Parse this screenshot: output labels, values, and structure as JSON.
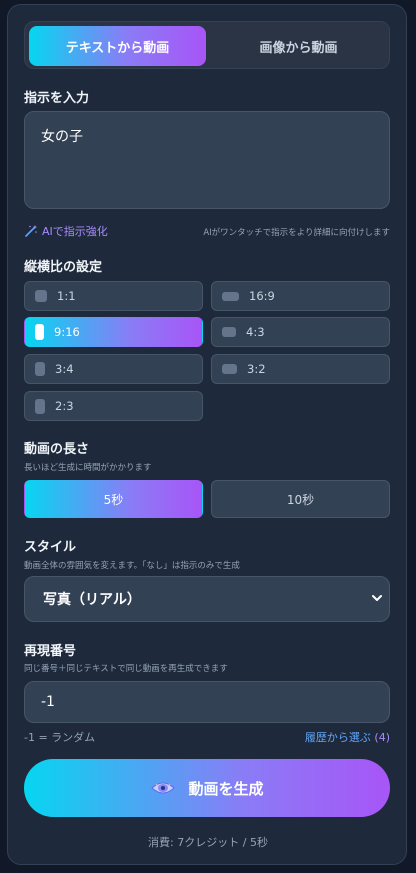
{
  "tabs": [
    {
      "label": "テキストから動画",
      "active": true
    },
    {
      "label": "画像から動画",
      "active": false
    }
  ],
  "instruction": {
    "label": "指示を入力",
    "value": "女の子",
    "enhance_label": "AIで指示強化",
    "enhance_hint": "AIがワンタッチで指示をより詳細に向付けします"
  },
  "aspect": {
    "label": "縦横比の設定",
    "options": [
      {
        "label": "1:1",
        "active": false
      },
      {
        "label": "16:9",
        "active": false
      },
      {
        "label": "9:16",
        "active": true
      },
      {
        "label": "4:3",
        "active": false
      },
      {
        "label": "3:4",
        "active": false
      },
      {
        "label": "3:2",
        "active": false
      },
      {
        "label": "2:3",
        "active": false
      }
    ]
  },
  "duration": {
    "label": "動画の長さ",
    "hint": "長いほど生成に時間がかかります",
    "options": [
      {
        "label": "5秒",
        "active": true
      },
      {
        "label": "10秒",
        "active": false
      }
    ]
  },
  "style": {
    "label": "スタイル",
    "hint": "動画全体の雰囲気を変えます。「なし」は指示のみで生成",
    "selected": "写真（リアル）"
  },
  "seed": {
    "label": "再現番号",
    "hint": "同じ番号＋同じテキストで同じ動画を再生成できます",
    "value": "-1",
    "random_hint": "-1 = ランダム",
    "history_label": "履歴から選ぶ",
    "history_count": "(4)"
  },
  "generate": {
    "label": "動画を生成",
    "icon": "sparkle-eye-icon"
  },
  "cost_text": "消費: 7クレジット / 5秒",
  "colors": {
    "accent_start": "#06d6f0",
    "accent_end": "#a855f7",
    "panel": "#1e293b",
    "control": "#334155"
  }
}
